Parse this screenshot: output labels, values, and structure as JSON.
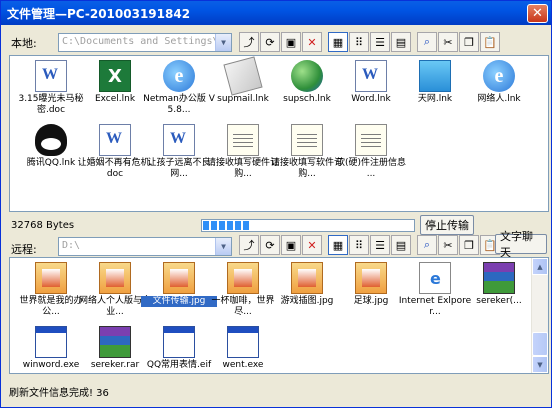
{
  "window": {
    "title": "文件管理—PC-201003191842",
    "close_glyph": "✕"
  },
  "local": {
    "label": "本地:",
    "path": "C:\\Documents and Settings\\Admir",
    "files": [
      {
        "name": "3.15曝光未马秘密.doc",
        "icon": "word-doc-icon"
      },
      {
        "name": "Excel.lnk",
        "icon": "excel-icon"
      },
      {
        "name": "Netman办公版 V5.8...",
        "icon": "ie-icon"
      },
      {
        "name": "supmail.lnk",
        "icon": "mail-icon"
      },
      {
        "name": "supsch.lnk",
        "icon": "globe-icon"
      },
      {
        "name": "Word.lnk",
        "icon": "word-icon"
      },
      {
        "name": "天网.lnk",
        "icon": "web-icon"
      },
      {
        "name": "网络人.lnk",
        "icon": "ie-icon"
      },
      {
        "name": "腾讯QQ.lnk",
        "icon": "qq-icon"
      },
      {
        "name": "让婚姻不再有危机.doc",
        "icon": "word-doc-icon"
      },
      {
        "name": "让孩子远离不良网...",
        "icon": "word-doc-icon"
      },
      {
        "name": "请接收填写硬件订购...",
        "icon": "notepad-icon"
      },
      {
        "name": "请接收填写软件订购...",
        "icon": "notepad-icon"
      },
      {
        "name": "软(硬)件注册信息 ...",
        "icon": "notepad-icon"
      }
    ]
  },
  "transfer": {
    "bytes": "32768 Bytes",
    "stop_label": "停止传输",
    "progress": 0.24
  },
  "remote": {
    "label": "远程:",
    "path": "D:\\",
    "chat_label": "文字聊天",
    "files": [
      {
        "name": "世界就是我的办公...",
        "icon": "jpg-icon"
      },
      {
        "name": "网络人个人版与企业...",
        "icon": "jpg-icon"
      },
      {
        "name": "文件传输.jpg",
        "icon": "jpg-icon",
        "selected": true
      },
      {
        "name": "一杯咖啡，世界尽...",
        "icon": "jpg-icon"
      },
      {
        "name": "游戏插图.jpg",
        "icon": "jpg-icon"
      },
      {
        "name": "足球.jpg",
        "icon": "jpg-icon"
      },
      {
        "name": "Internet Exlporer...",
        "icon": "htm-icon"
      },
      {
        "name": "sereker(...",
        "icon": "rar-icon"
      },
      {
        "name": "winword.exe",
        "icon": "exe-icon"
      },
      {
        "name": "sereker.rar",
        "icon": "rar-icon"
      },
      {
        "name": "QQ常用表情.eif",
        "icon": "exe-icon"
      },
      {
        "name": "went.exe",
        "icon": "exe-icon"
      }
    ]
  },
  "status": {
    "message": "刷新文件信息完成! 36"
  },
  "toolbar_icons": [
    "up-folder-icon",
    "refresh-icon",
    "new-folder-icon",
    "delete-icon",
    "large-icons-view-icon",
    "small-icons-view-icon",
    "list-view-icon",
    "details-view-icon",
    "find-icon",
    "cut-icon",
    "copy-icon",
    "paste-icon"
  ]
}
